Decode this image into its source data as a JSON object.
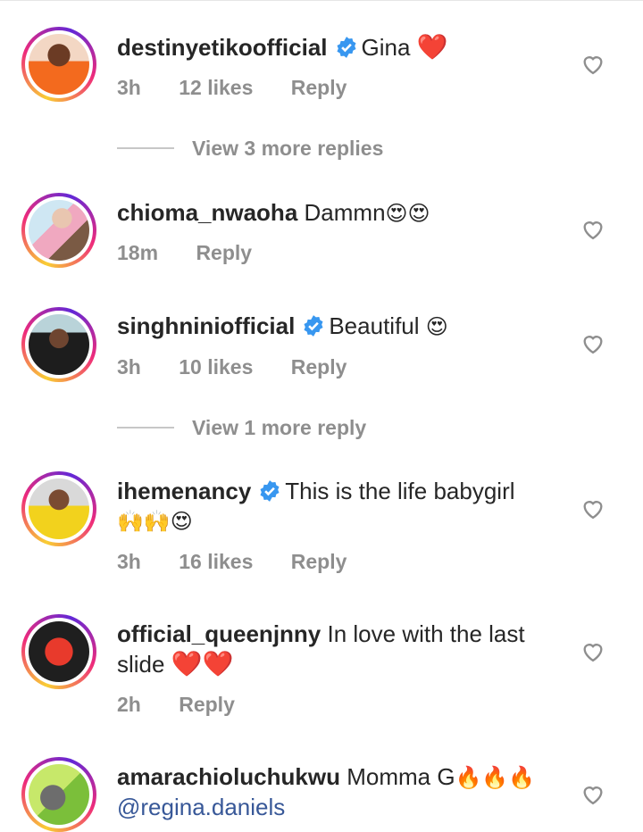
{
  "comments": [
    {
      "username": "destinyetikoofficial",
      "verified": true,
      "text": "Gina",
      "emoji": "❤️",
      "time": "3h",
      "likes": "12 likes",
      "reply": "Reply",
      "view_replies": "View 3 more replies"
    },
    {
      "username": "chioma_nwaoha",
      "verified": false,
      "text": "Dammn",
      "emoji": "😍😍",
      "time": "18m",
      "reply": "Reply"
    },
    {
      "username": "singhniniofficial",
      "verified": true,
      "text": "Beautiful",
      "emoji": "😍",
      "time": "3h",
      "likes": "10 likes",
      "reply": "Reply",
      "view_replies": "View 1 more reply"
    },
    {
      "username": "ihemenancy",
      "verified": true,
      "text": "This is the life babygirl",
      "emoji": "🙌🙌😍",
      "time": "3h",
      "likes": "16 likes",
      "reply": "Reply"
    },
    {
      "username": "official_queenjnny",
      "verified": false,
      "text": "In love with the last slide",
      "emoji": "❤️❤️",
      "time": "2h",
      "reply": "Reply"
    },
    {
      "username": "amarachioluchukwu",
      "verified": false,
      "text": "Momma G",
      "emoji": "🔥🔥🔥",
      "mention": "@regina.daniels"
    }
  ],
  "icons": {
    "like": "heart-outline-icon",
    "verified": "verified-badge-icon"
  },
  "colors": {
    "verified": "#3897f0",
    "mention": "#385898",
    "meta": "#8e8e8e"
  }
}
